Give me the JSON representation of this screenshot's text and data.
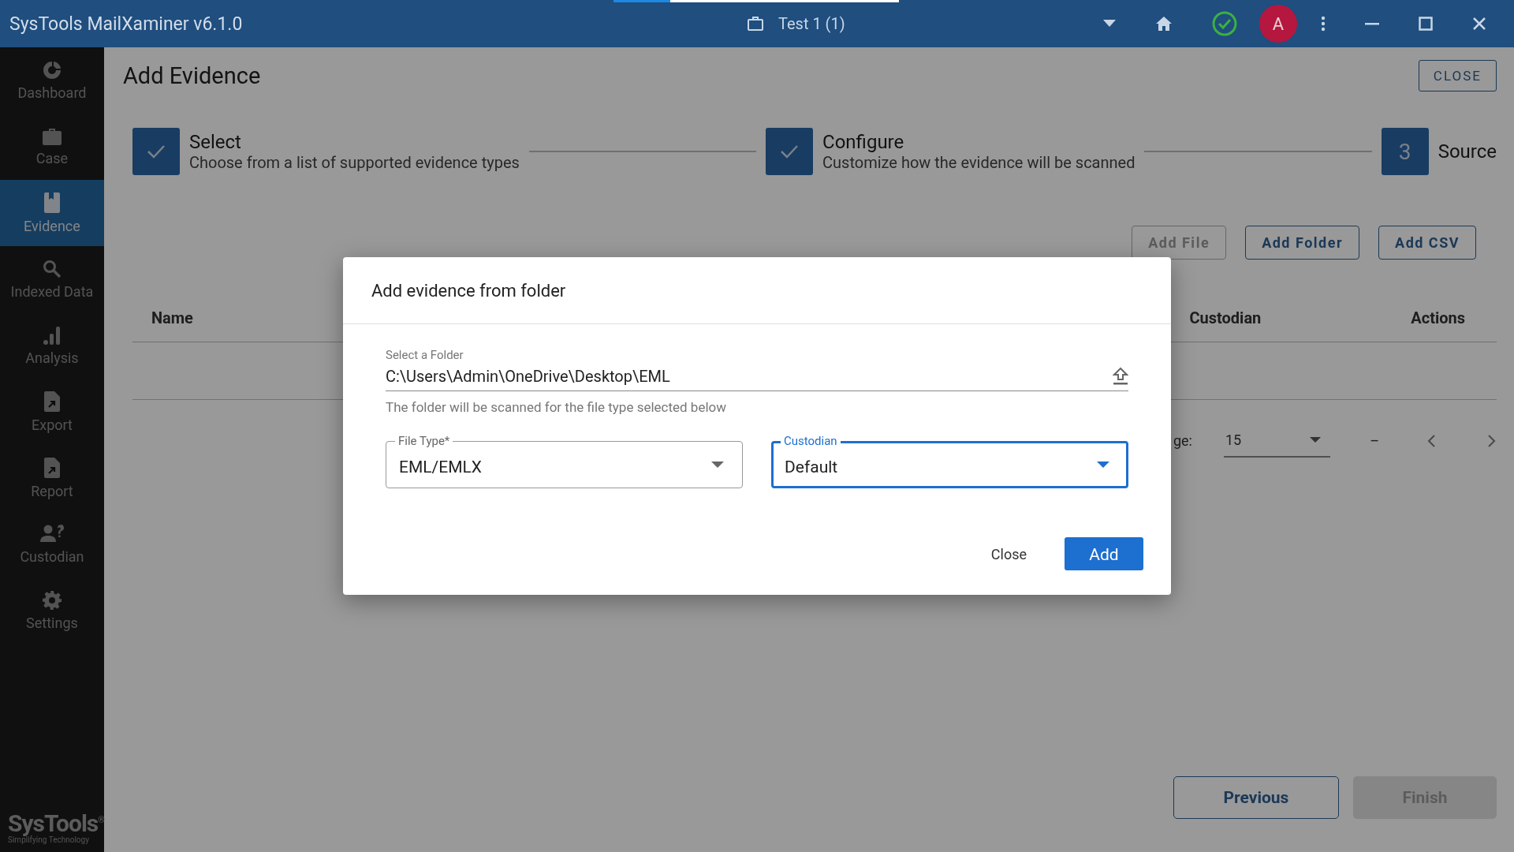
{
  "window": {
    "title": "SysTools MailXaminer v6.1.0",
    "case_name": "Test 1 (1)",
    "avatar": "A",
    "online": true
  },
  "sidebar": {
    "items": [
      {
        "label": "Dashboard",
        "selected": false
      },
      {
        "label": "Case",
        "selected": false
      },
      {
        "label": "Evidence",
        "selected": true
      },
      {
        "label": "Indexed Data",
        "selected": false
      },
      {
        "label": "Analysis",
        "selected": false
      },
      {
        "label": "Export",
        "selected": false
      },
      {
        "label": "Report",
        "selected": false
      },
      {
        "label": "Custodian",
        "selected": false
      },
      {
        "label": "Settings",
        "selected": false
      }
    ],
    "logo": {
      "brand": "SysTools",
      "tagline": "Simplifying Technology",
      "mark": "®"
    }
  },
  "page": {
    "title": "Add Evidence",
    "close_button": "CLOSE"
  },
  "steps": [
    {
      "title": "Select",
      "description": "Choose from a list of supported evidence types",
      "done": true
    },
    {
      "title": "Configure",
      "description": "Customize how the evidence will be scanned",
      "done": true
    },
    {
      "title": "Source",
      "done": false,
      "number": "3"
    }
  ],
  "actions": [
    {
      "label": "Add File",
      "disabled": true
    },
    {
      "label": "Add Folder",
      "disabled": false
    },
    {
      "label": "Add CSV",
      "disabled": false
    }
  ],
  "table": {
    "columns": [
      "Name",
      "Custodian",
      "Actions"
    ]
  },
  "pagination": {
    "label": "ge:",
    "page_size": "15",
    "range": "–"
  },
  "footer_buttons": [
    {
      "label": "Previous",
      "disabled": false
    },
    {
      "label": "Finish",
      "disabled": true
    }
  ],
  "dialog": {
    "title": "Add evidence from folder",
    "folder": {
      "label": "Select a Folder",
      "value": "C:\\Users\\Admin\\OneDrive\\Desktop\\EML",
      "hint": "The folder will be scanned for the file type selected below"
    },
    "selects": [
      {
        "label": "File Type*",
        "value": "EML/EMLX",
        "focused": false
      },
      {
        "label": "Custodian",
        "value": "Default",
        "focused": true
      }
    ],
    "buttons": [
      {
        "label": "Close",
        "kind": "text"
      },
      {
        "label": "Add",
        "kind": "primary"
      }
    ]
  }
}
